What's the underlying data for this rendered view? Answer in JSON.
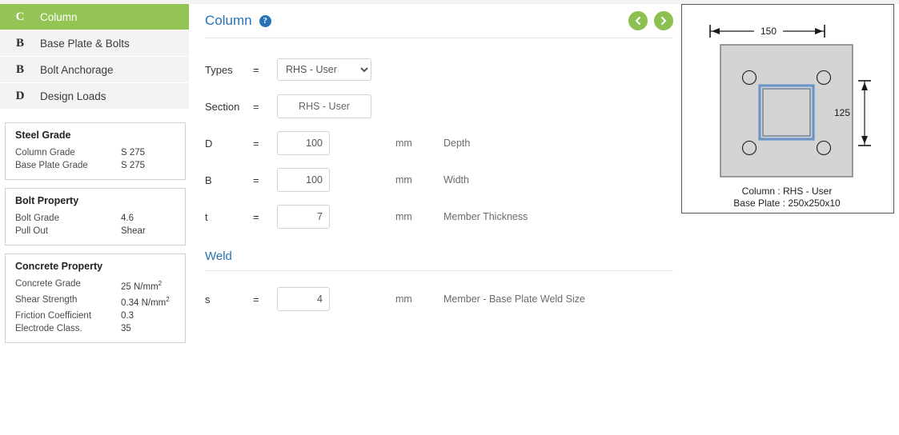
{
  "sidebar": {
    "nav": [
      {
        "badge": "C",
        "label": "Column",
        "active": true
      },
      {
        "badge": "B",
        "label": "Base Plate & Bolts",
        "active": false
      },
      {
        "badge": "B",
        "label": "Bolt Anchorage",
        "active": false
      },
      {
        "badge": "D",
        "label": "Design Loads",
        "active": false
      }
    ],
    "cards": [
      {
        "title": "Steel Grade",
        "rows": [
          {
            "key": "Column Grade",
            "value": "S 275"
          },
          {
            "key": "Base Plate Grade",
            "value": "S 275"
          }
        ]
      },
      {
        "title": "Bolt Property",
        "rows": [
          {
            "key": "Bolt Grade",
            "value": "4.6"
          },
          {
            "key": "Pull Out",
            "value": "Shear"
          }
        ]
      },
      {
        "title": "Concrete Property",
        "rows": [
          {
            "key": "Concrete Grade",
            "value": "25 N/mm",
            "sup": "2"
          },
          {
            "key": "Shear Strength",
            "value": "0.34 N/mm",
            "sup": "2"
          },
          {
            "key": "Friction Coefficient",
            "value": "0.3"
          },
          {
            "key": "Electrode Class.",
            "value": "35"
          }
        ]
      }
    ]
  },
  "main": {
    "title": "Column",
    "help_icon": "question-mark-icon",
    "prev_label": "prev-arrow-icon",
    "next_label": "next-arrow-icon",
    "fields": {
      "types": {
        "label": "Types",
        "eq": "=",
        "value": "RHS - User",
        "options": [
          "RHS - User"
        ]
      },
      "section": {
        "label": "Section",
        "eq": "=",
        "value": "RHS - User"
      },
      "depth": {
        "label": "D",
        "eq": "=",
        "value": "100",
        "unit": "mm",
        "desc": "Depth"
      },
      "width": {
        "label": "B",
        "eq": "=",
        "value": "100",
        "unit": "mm",
        "desc": "Width"
      },
      "thickness": {
        "label": "t",
        "eq": "=",
        "value": "7",
        "unit": "mm",
        "desc": "Member Thickness"
      }
    },
    "weld": {
      "heading": "Weld",
      "size": {
        "label": "s",
        "eq": "=",
        "value": "4",
        "unit": "mm",
        "desc": "Member - Base Plate Weld Size"
      }
    }
  },
  "diagram": {
    "dim_horizontal": "150",
    "dim_vertical": "125",
    "caption_line1": "Column : RHS - User",
    "caption_line2": "Base Plate : 250x250x10"
  },
  "colors": {
    "accent_green": "#94c554",
    "title_blue": "#2572b4",
    "plate_fill": "#d4d4d4",
    "column_blue": "#6b94c9"
  }
}
